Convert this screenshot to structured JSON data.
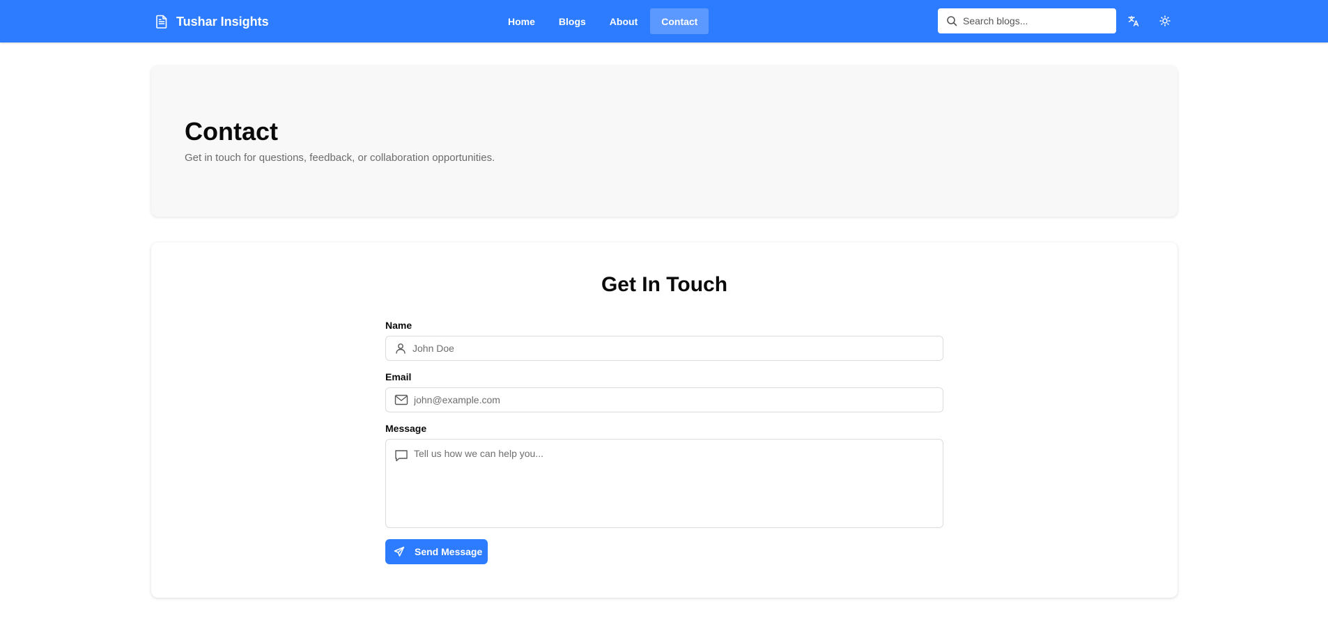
{
  "header": {
    "brand": "Tushar Insights",
    "brand_icon": "document-icon",
    "nav": [
      {
        "label": "Home",
        "active": false
      },
      {
        "label": "Blogs",
        "active": false
      },
      {
        "label": "About",
        "active": false
      },
      {
        "label": "Contact",
        "active": true
      }
    ],
    "search_placeholder": "Search blogs...",
    "actions": [
      "translate-icon",
      "sun-icon"
    ]
  },
  "hero": {
    "title": "Contact",
    "subtitle": "Get in touch for questions, feedback, or collaboration opportunities."
  },
  "form": {
    "title": "Get In Touch",
    "name_label": "Name",
    "name_placeholder": "John Doe",
    "email_label": "Email",
    "email_placeholder": "john@example.com",
    "message_label": "Message",
    "message_placeholder": "Tell us how we can help you...",
    "submit_label": "Send Message"
  },
  "colors": {
    "primary": "#2d7cff",
    "hero_bg": "#f8f8f8",
    "muted_text": "#6b6b6b"
  }
}
